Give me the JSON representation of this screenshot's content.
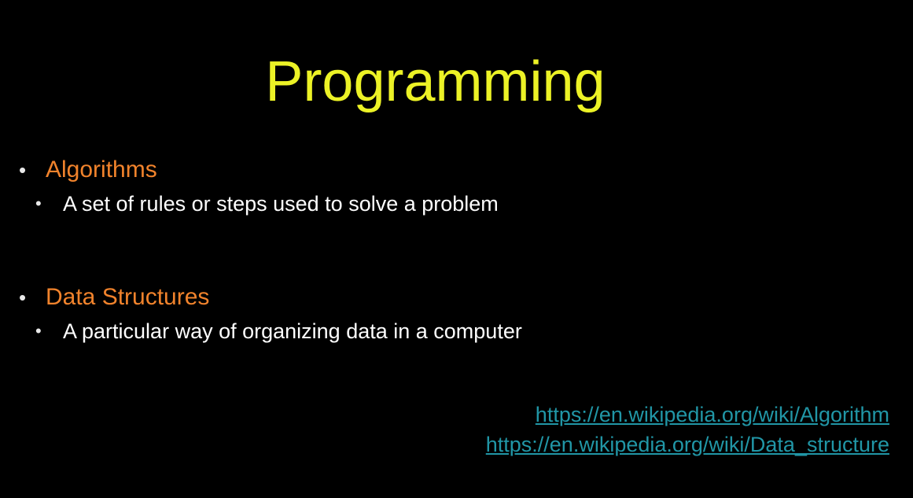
{
  "slide": {
    "title": "Programming",
    "bullets": [
      {
        "heading": "Algorithms",
        "detail": "A set of rules or steps used to solve a problem"
      },
      {
        "heading": "Data Structures",
        "detail": "A particular way of organizing data in a computer"
      }
    ],
    "links": [
      "https://en.wikipedia.org/wiki/Algorithm",
      "https://en.wikipedia.org/wiki/Data_structure"
    ],
    "bullet_glyph": "•",
    "colors": {
      "background": "#000000",
      "title": "#ecf226",
      "heading": "#f1832c",
      "detail": "#ffffff",
      "link": "#2196a6"
    }
  }
}
